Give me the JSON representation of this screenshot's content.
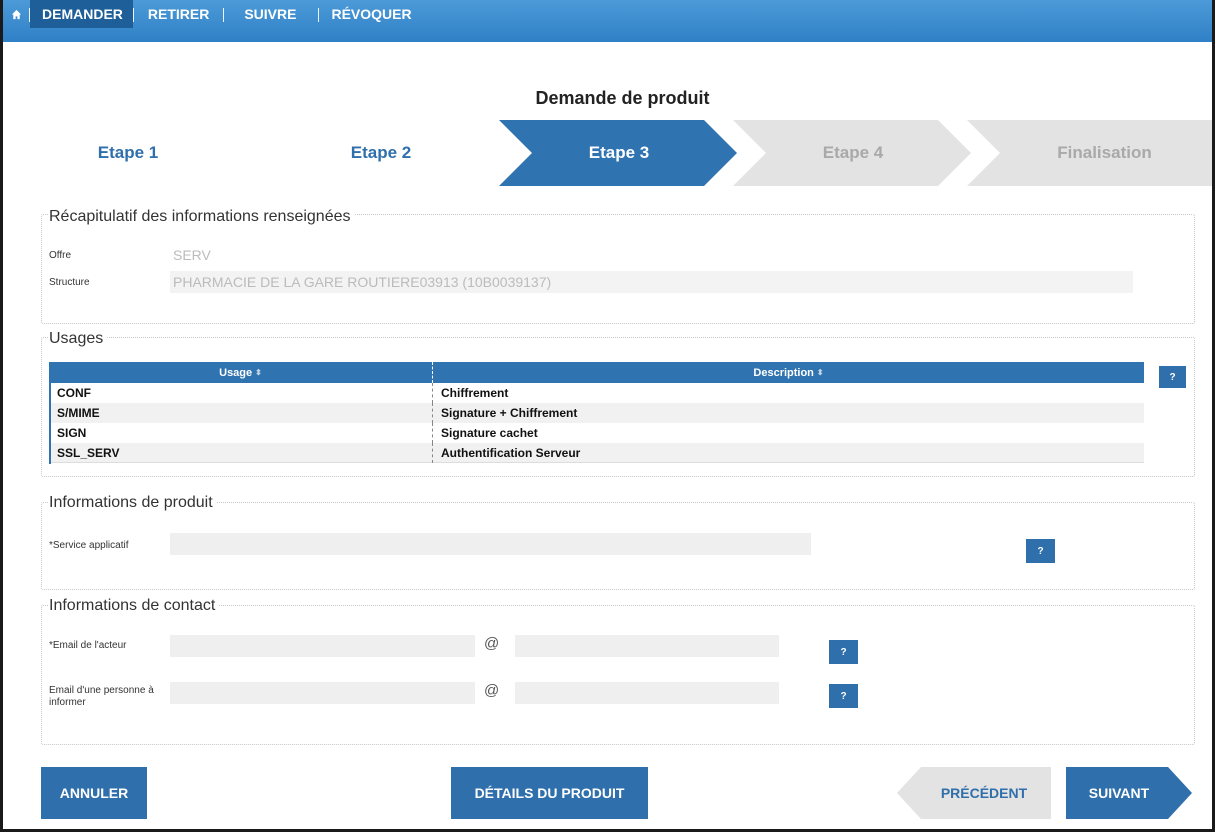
{
  "nav": {
    "items": [
      {
        "label": "DEMANDER",
        "active": true
      },
      {
        "label": "RETIRER",
        "active": false
      },
      {
        "label": "SUIVRE",
        "active": false
      },
      {
        "label": "RÉVOQUER",
        "active": false
      }
    ]
  },
  "page": {
    "title": "Demande de produit"
  },
  "stepper": {
    "steps": [
      {
        "label": "Etape 1",
        "state": "done"
      },
      {
        "label": "Etape 2",
        "state": "done"
      },
      {
        "label": "Etape 3",
        "state": "current"
      },
      {
        "label": "Etape 4",
        "state": "todo"
      },
      {
        "label": "Finalisation",
        "state": "todo"
      }
    ]
  },
  "recap": {
    "legend": "Récapitulatif des informations renseignées",
    "offre_label": "Offre",
    "offre_value": "SERV",
    "structure_label": "Structure",
    "structure_value": "PHARMACIE DE LA GARE ROUTIERE03913 (10B0039137)"
  },
  "usages": {
    "legend": "Usages",
    "columns": [
      "Usage",
      "Description"
    ],
    "rows": [
      {
        "usage": "CONF",
        "description": "Chiffrement"
      },
      {
        "usage": "S/MIME",
        "description": "Signature + Chiffrement"
      },
      {
        "usage": "SIGN",
        "description": "Signature cachet"
      },
      {
        "usage": "SSL_SERV",
        "description": "Authentification Serveur"
      }
    ],
    "help_label": "?"
  },
  "produit": {
    "legend": "Informations de produit",
    "service_label": "*Service applicatif",
    "service_value": "",
    "help_label": "?"
  },
  "contact": {
    "legend": "Informations de contact",
    "email_acteur_label": "*Email de l'acteur",
    "email_informer_label": "Email d'une personne à informer",
    "at_symbol": "@",
    "help_label": "?"
  },
  "actions": {
    "cancel": "ANNULER",
    "details": "DÉTAILS DU PRODUIT",
    "previous": "PRÉCÉDENT",
    "next": "SUIVANT"
  },
  "colors": {
    "primary": "#2f6fab",
    "nav": "#3a88cc",
    "step_todo": "#e6e6e6",
    "step_done": "#ffffff"
  }
}
